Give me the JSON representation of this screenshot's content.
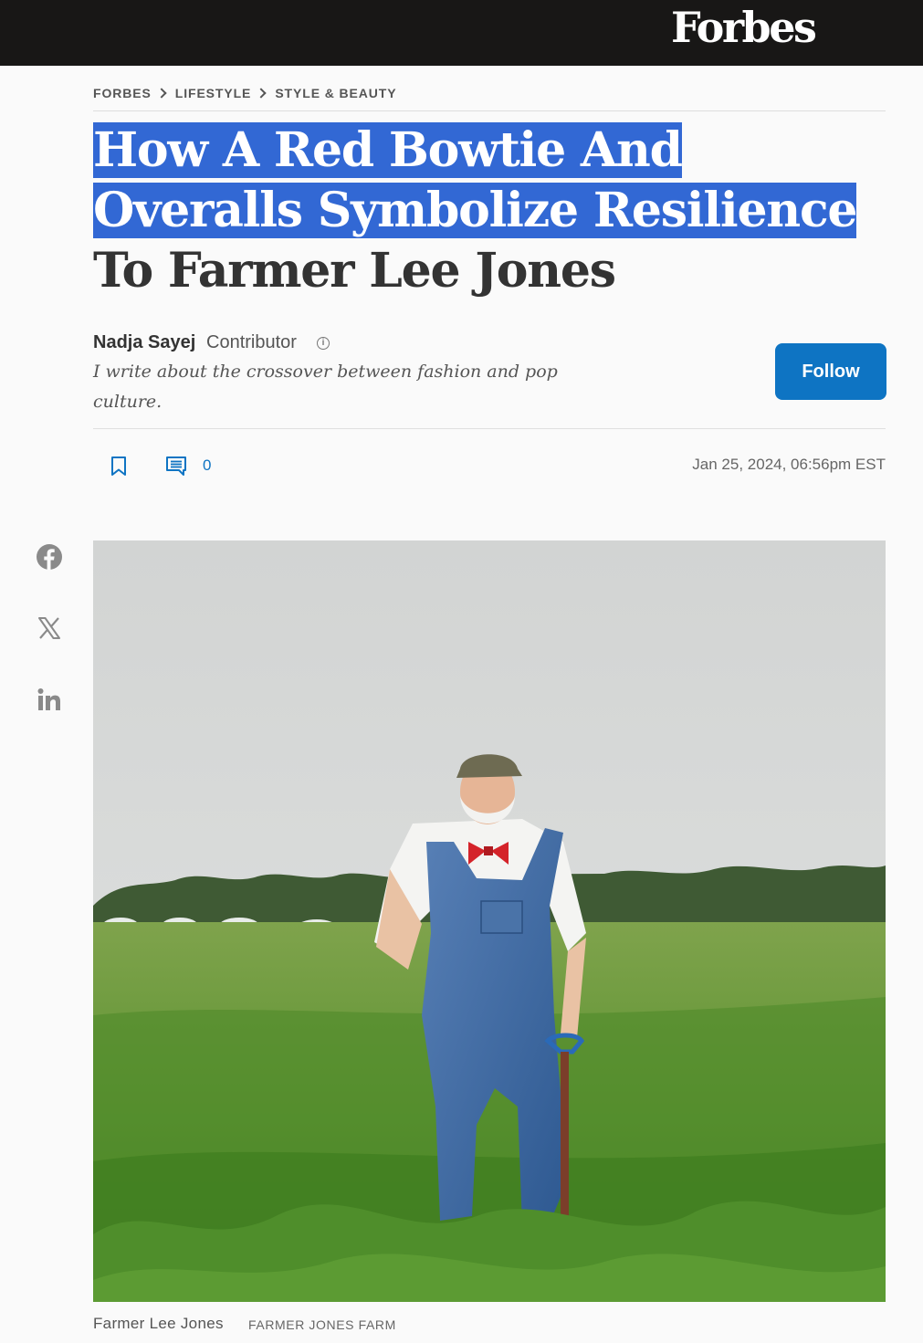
{
  "header": {
    "logo": "Forbes"
  },
  "breadcrumb": [
    "FORBES",
    "LIFESTYLE",
    "STYLE & BEAUTY"
  ],
  "article": {
    "headline_highlighted": "How A Red Bowtie And Overalls Symbolize Resilience",
    "headline_rest": " To Farmer Lee Jones",
    "author": {
      "name": "Nadja Sayej",
      "role": "Contributor",
      "bio": "I write about the crossover between fashion and pop culture."
    },
    "follow_label": "Follow",
    "comment_count": "0",
    "timestamp": "Jan 25, 2024, 06:56pm EST",
    "image_caption": "Farmer Lee Jones",
    "image_credit": "FARMER JONES FARM"
  },
  "share": [
    "facebook-icon",
    "x-icon",
    "linkedin-icon"
  ],
  "colors": {
    "topbar": "#181716",
    "accent": "#0e74c3",
    "selection": "#3268d4"
  }
}
